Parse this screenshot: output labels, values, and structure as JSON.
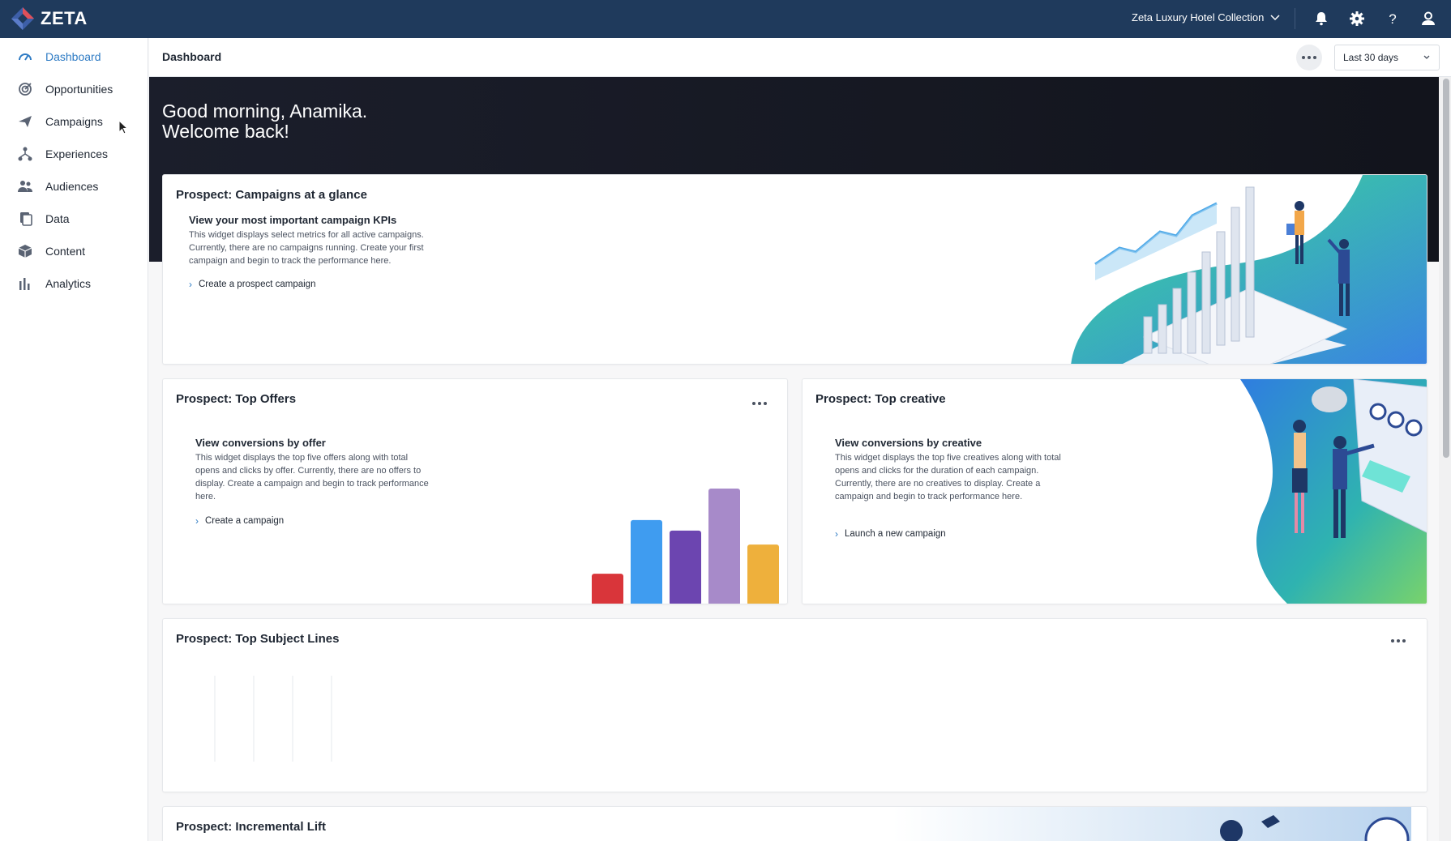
{
  "topbar": {
    "logo_text": "ZETA",
    "account_name": "Zeta Luxury Hotel Collection",
    "icons": [
      "bell-icon",
      "gear-icon",
      "help-icon",
      "user-icon"
    ]
  },
  "sidebar": {
    "items": [
      {
        "label": "Dashboard",
        "icon": "dashboard-icon",
        "active": true
      },
      {
        "label": "Opportunities",
        "icon": "target-icon"
      },
      {
        "label": "Campaigns",
        "icon": "paper-plane-icon"
      },
      {
        "label": "Experiences",
        "icon": "flow-icon"
      },
      {
        "label": "Audiences",
        "icon": "people-icon"
      },
      {
        "label": "Data",
        "icon": "database-icon"
      },
      {
        "label": "Content",
        "icon": "cube-icon"
      },
      {
        "label": "Analytics",
        "icon": "bar-chart-icon"
      }
    ]
  },
  "header": {
    "title": "Dashboard",
    "date_range": "Last 30 days"
  },
  "hero": {
    "greeting_line1": "Good morning, Anamika.",
    "greeting_line2": "Welcome back!"
  },
  "cards": {
    "glance": {
      "title": "Prospect: Campaigns at a glance",
      "subtitle": "View your most important campaign KPIs",
      "description": "This widget displays select metrics for all active campaigns. Currently, there are no campaigns running. Create your first campaign and begin to track the performance here.",
      "link": "Create a prospect campaign"
    },
    "offers": {
      "title": "Prospect: Top Offers",
      "subtitle": "View conversions by offer",
      "description": "This widget displays the top five offers along with total opens and clicks by offer. Currently, there are no offers to display. Create a campaign and begin to track performance here.",
      "link": "Create a campaign",
      "bar_levels": [
        0.27,
        0.73,
        0.64,
        1.0,
        0.52
      ],
      "bar_colors": [
        "#d9353a",
        "#3f9cf0",
        "#6c45b0",
        "#a78ac9",
        "#eeb03c"
      ]
    },
    "creative": {
      "title": "Prospect: Top creative",
      "subtitle": "View conversions by creative",
      "description": "This widget displays the top five creatives along with total opens and clicks for the duration of each campaign. Currently, there are no creatives to display. Create a campaign and begin to track performance here.",
      "link": "Launch a new campaign"
    },
    "subject": {
      "title": "Prospect: Top Subject Lines"
    },
    "lift": {
      "title": "Prospect: Incremental Lift"
    }
  }
}
